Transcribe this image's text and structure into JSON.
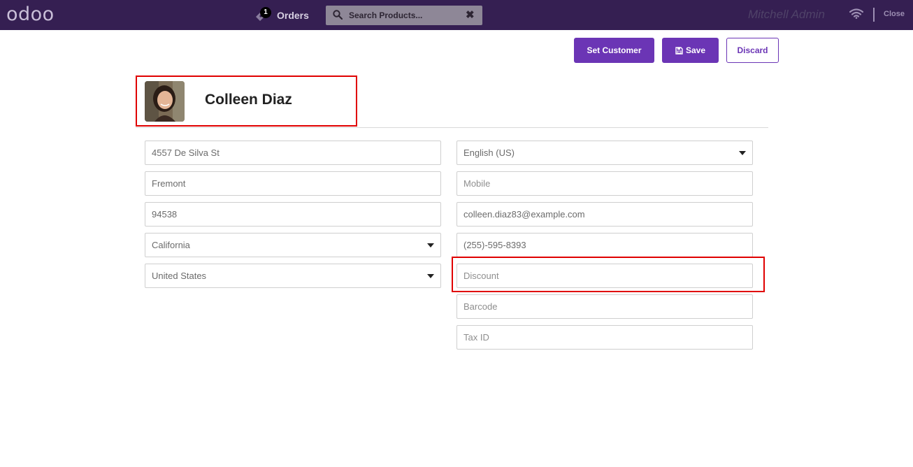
{
  "topbar": {
    "logo": "odoo",
    "orders_count": "1",
    "orders_label": "Orders",
    "search_placeholder": "Search Products...",
    "clear_icon": "✖",
    "user": "Mitchell Admin",
    "close_label": "Close"
  },
  "actions": {
    "set_customer": "Set Customer",
    "save": "Save",
    "discard": "Discard"
  },
  "customer": {
    "name": "Colleen Diaz"
  },
  "form": {
    "street": "4557 De Silva St",
    "city": "Fremont",
    "zip": "94538",
    "state": "California",
    "country": "United States",
    "language": "English (US)",
    "mobile_placeholder": "Mobile",
    "email": "colleen.diaz83@example.com",
    "phone": "(255)-595-8393",
    "discount_placeholder": "Discount",
    "barcode_placeholder": "Barcode",
    "tax_id_placeholder": "Tax ID"
  },
  "colors": {
    "topbar": "#351f52",
    "primary": "#6b35b5",
    "highlight": "#e00000"
  }
}
